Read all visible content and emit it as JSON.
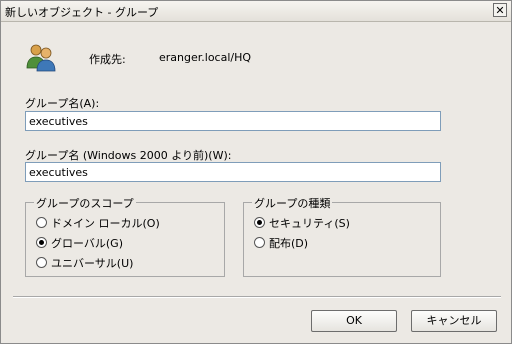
{
  "window": {
    "title": "新しいオブジェクト - グループ",
    "close_icon": "close-icon"
  },
  "header": {
    "icon": "group-users-icon",
    "create_in_label": "作成先:",
    "create_in_value": "eranger.local/HQ"
  },
  "fields": {
    "group_name_label": "グループ名(A):",
    "group_name_value": "executives",
    "group_name_pre2000_label": "グループ名 (Windows 2000 より前)(W):",
    "group_name_pre2000_value": "executives"
  },
  "scope": {
    "title": "グループのスコープ",
    "options": [
      "ドメイン ローカル(O)",
      "グローバル(G)",
      "ユニバーサル(U)"
    ],
    "selected": "グローバル(G)"
  },
  "type": {
    "title": "グループの種類",
    "options": [
      "セキュリティ(S)",
      "配布(D)"
    ],
    "selected": "セキュリティ(S)"
  },
  "buttons": {
    "ok": "OK",
    "cancel": "キャンセル"
  }
}
